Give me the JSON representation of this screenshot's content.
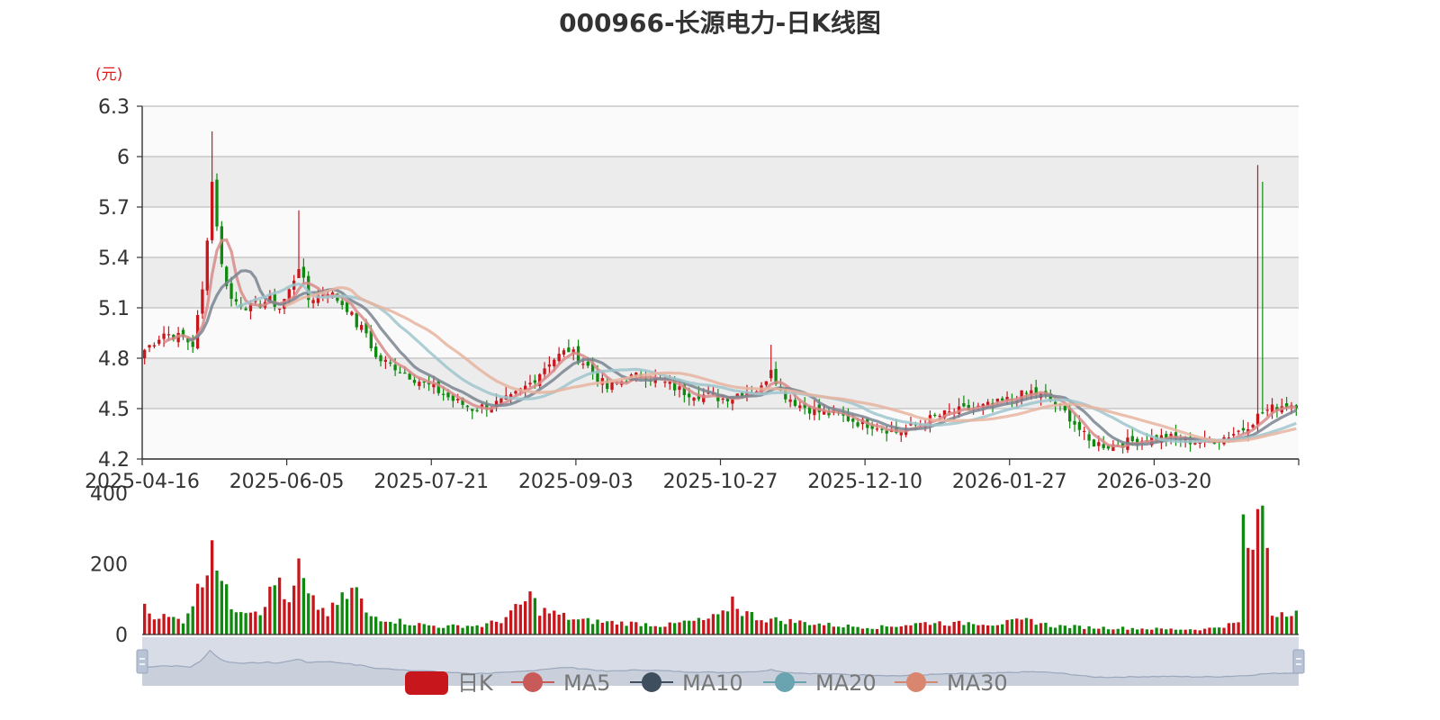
{
  "chart_data": {
    "type": "candlestick",
    "title": "000966-长源电力-日K线图",
    "y_unit": "(元)",
    "price_axis": {
      "min": 4.2,
      "max": 6.3,
      "ticks": [
        "6.3",
        "6",
        "5.7",
        "5.4",
        "5.1",
        "4.8",
        "4.5",
        "4.2"
      ]
    },
    "volume_axis": {
      "min": 0,
      "max": 400,
      "ticks": [
        "400",
        "200",
        "0"
      ]
    },
    "x_ticks": [
      "2025-04-16",
      "2025-06-05",
      "2025-07-21",
      "2025-09-03",
      "2025-10-27",
      "2025-12-10",
      "2026-01-27",
      "2026-03-20"
    ],
    "colors": {
      "up": "#c8161d",
      "down": "#0f8a0f",
      "ma5": "#d98b8b",
      "ma10": "#7a8591",
      "ma20": "#9fc6cc",
      "ma30": "#e8b4a0",
      "band": "#ececec",
      "grid": "#c8c8c8",
      "slider": "#d7dce6",
      "slider_line": "#9aa6bb"
    },
    "legend": [
      "日K",
      "MA5",
      "MA10",
      "MA20",
      "MA30"
    ],
    "grid": true,
    "bar_count": 240,
    "close_anchors": [
      [
        0,
        4.85
      ],
      [
        4,
        4.95
      ],
      [
        8,
        4.92
      ],
      [
        10,
        4.88
      ],
      [
        12,
        5.2
      ],
      [
        14,
        5.85
      ],
      [
        16,
        5.35
      ],
      [
        18,
        5.15
      ],
      [
        22,
        5.1
      ],
      [
        26,
        5.15
      ],
      [
        28,
        5.1
      ],
      [
        30,
        5.2
      ],
      [
        32,
        5.35
      ],
      [
        34,
        5.15
      ],
      [
        38,
        5.2
      ],
      [
        42,
        5.1
      ],
      [
        44,
        5.0
      ],
      [
        46,
        4.95
      ],
      [
        48,
        4.8
      ],
      [
        52,
        4.75
      ],
      [
        56,
        4.68
      ],
      [
        60,
        4.62
      ],
      [
        64,
        4.55
      ],
      [
        68,
        4.5
      ],
      [
        72,
        4.52
      ],
      [
        76,
        4.56
      ],
      [
        80,
        4.65
      ],
      [
        84,
        4.78
      ],
      [
        88,
        4.85
      ],
      [
        92,
        4.75
      ],
      [
        96,
        4.62
      ],
      [
        100,
        4.68
      ],
      [
        104,
        4.7
      ],
      [
        108,
        4.65
      ],
      [
        112,
        4.6
      ],
      [
        116,
        4.58
      ],
      [
        120,
        4.56
      ],
      [
        124,
        4.6
      ],
      [
        128,
        4.62
      ],
      [
        130,
        4.75
      ],
      [
        132,
        4.6
      ],
      [
        136,
        4.52
      ],
      [
        140,
        4.48
      ],
      [
        144,
        4.46
      ],
      [
        148,
        4.42
      ],
      [
        152,
        4.4
      ],
      [
        156,
        4.36
      ],
      [
        160,
        4.4
      ],
      [
        164,
        4.45
      ],
      [
        168,
        4.48
      ],
      [
        172,
        4.5
      ],
      [
        176,
        4.52
      ],
      [
        180,
        4.56
      ],
      [
        184,
        4.6
      ],
      [
        188,
        4.55
      ],
      [
        192,
        4.45
      ],
      [
        196,
        4.3
      ],
      [
        200,
        4.28
      ],
      [
        204,
        4.3
      ],
      [
        208,
        4.32
      ],
      [
        212,
        4.33
      ],
      [
        216,
        4.31
      ],
      [
        220,
        4.3
      ],
      [
        224,
        4.33
      ],
      [
        228,
        4.38
      ],
      [
        232,
        4.48
      ],
      [
        236,
        4.52
      ],
      [
        239,
        4.53
      ]
    ],
    "volume_anchors": [
      [
        0,
        100
      ],
      [
        1,
        60
      ],
      [
        4,
        50
      ],
      [
        8,
        40
      ],
      [
        10,
        95
      ],
      [
        12,
        150
      ],
      [
        14,
        290
      ],
      [
        16,
        150
      ],
      [
        18,
        80
      ],
      [
        24,
        70
      ],
      [
        28,
        160
      ],
      [
        30,
        75
      ],
      [
        32,
        190
      ],
      [
        34,
        100
      ],
      [
        38,
        60
      ],
      [
        42,
        110
      ],
      [
        44,
        130
      ],
      [
        46,
        55
      ],
      [
        52,
        40
      ],
      [
        56,
        30
      ],
      [
        62,
        22
      ],
      [
        66,
        25
      ],
      [
        70,
        25
      ],
      [
        74,
        40
      ],
      [
        78,
        80
      ],
      [
        80,
        110
      ],
      [
        82,
        70
      ],
      [
        86,
        55
      ],
      [
        90,
        40
      ],
      [
        96,
        35
      ],
      [
        104,
        30
      ],
      [
        108,
        25
      ],
      [
        112,
        35
      ],
      [
        116,
        40
      ],
      [
        120,
        55
      ],
      [
        122,
        100
      ],
      [
        124,
        65
      ],
      [
        128,
        45
      ],
      [
        136,
        35
      ],
      [
        144,
        25
      ],
      [
        152,
        20
      ],
      [
        160,
        30
      ],
      [
        164,
        35
      ],
      [
        168,
        30
      ],
      [
        172,
        35
      ],
      [
        176,
        30
      ],
      [
        180,
        35
      ],
      [
        184,
        40
      ],
      [
        188,
        25
      ],
      [
        196,
        20
      ],
      [
        204,
        18
      ],
      [
        212,
        15
      ],
      [
        220,
        15
      ],
      [
        228,
        35
      ],
      [
        236,
        65
      ],
      [
        239,
        70
      ]
    ]
  }
}
